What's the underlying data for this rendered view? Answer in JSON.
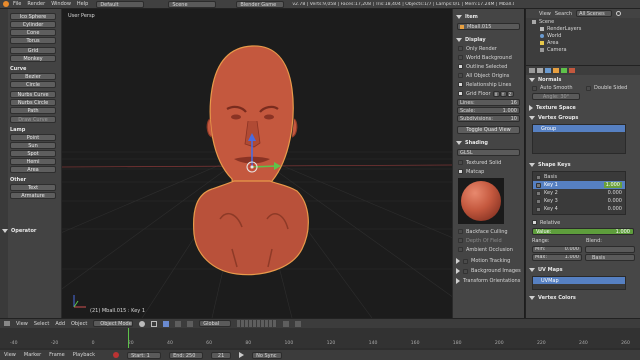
{
  "topbar": {
    "menus": [
      "File",
      "Render",
      "Window",
      "Help"
    ],
    "screen": "Default",
    "scene": "Scene",
    "engine": "Blender Game",
    "stats": "v2.78 | Verts:9,058 | Faces:17,208 | Tris:18,404 | Objects:1/7 | Lamps:0/1 | Mem:17.24M | Mball.015"
  },
  "toolshelf": {
    "items_top": [
      "Ico Sphere",
      "Cylinder",
      "Cone",
      "Torus",
      "Grid",
      "Monkey"
    ],
    "curve_title": "Curve",
    "curve_items": [
      "Bezier",
      "Circle",
      "Nurbs Curve",
      "Nurbs Circle",
      "Path",
      "Draw Curve"
    ],
    "lamp_title": "Lamp",
    "lamp_items": [
      "Point",
      "Sun",
      "Spot",
      "Hemi",
      "Area"
    ],
    "other_title": "Other",
    "other_items": [
      "Text",
      "Armature"
    ],
    "operator": "Operator"
  },
  "viewport": {
    "label": "User Persp",
    "object_label": "(21) Mball.015 : Key 1"
  },
  "npanel": {
    "item_title": "Item",
    "item_name": "Mball.015",
    "display_title": "Display",
    "display_checks": [
      "Only Render",
      "World Background",
      "Outline Selected",
      "All Object Origins",
      "Relationship Lines"
    ],
    "grid_floor": "Grid Floor",
    "axes": [
      "X",
      "Y",
      "Z"
    ],
    "lines_label": "Lines:",
    "lines_value": "16",
    "scale_label": "Scale:",
    "scale_value": "1.000",
    "subdiv_label": "Subdivisions:",
    "subdiv_value": "10",
    "toggle_quad": "Toggle Quad View",
    "shading_title": "Shading",
    "shading_mode": "GLSL",
    "textured_solid": "Textured Solid",
    "matcap": "Matcap",
    "lower_checks": [
      "Backface Culling",
      "Depth Of Field",
      "Ambient Occlusion"
    ],
    "sections": [
      "Motion Tracking",
      "Background Images",
      "Transform Orientations"
    ]
  },
  "outliner": {
    "tabs": [
      "View",
      "Search",
      "All Scenes"
    ],
    "items": [
      "Scene",
      "RenderLayers",
      "World",
      "Area",
      "Camera"
    ]
  },
  "properties": {
    "normals_title": "Normals",
    "auto_smooth": "Auto Smooth",
    "double_sided": "Double Sided",
    "angle": "Angle: 30°",
    "texture_space": "Texture Space",
    "vertex_groups": "Vertex Groups",
    "group_name": "Group",
    "shape_keys_title": "Shape Keys",
    "shape_keys": [
      {
        "name": "Basis",
        "value": ""
      },
      {
        "name": "Key 1",
        "value": "1.000"
      },
      {
        "name": "Key 2",
        "value": "0.000"
      },
      {
        "name": "Key 3",
        "value": "0.000"
      },
      {
        "name": "Key 4",
        "value": "0.000"
      }
    ],
    "relative": "Relative",
    "value_label": "Value:",
    "value": "1.000",
    "range_label": "Range:",
    "blend_label": "Blend:",
    "min_label": "Min:",
    "min_value": "0.000",
    "max_label": "Max:",
    "max_value": "1.000",
    "blend_value": "Basis",
    "uv_maps": "UV Maps",
    "uv_name": "UVMap",
    "vertex_colors": "Vertex Colors"
  },
  "viewheader": {
    "menus": [
      "View",
      "Select",
      "Add",
      "Object"
    ],
    "mode": "Object Mode",
    "orientation": "Global"
  },
  "timeline": {
    "labels": [
      "View",
      "Marker",
      "Frame",
      "Playback"
    ],
    "start": "Start: 1",
    "end": "End: 250",
    "current": "21",
    "sync": "No Sync",
    "ticks": [
      "-40",
      "-20",
      "0",
      "20",
      "40",
      "60",
      "80",
      "100",
      "120",
      "140",
      "160",
      "180",
      "200",
      "220",
      "240",
      "260"
    ]
  },
  "colors": {
    "skin": "#c4583e",
    "accent": "#5680c2",
    "green_axis": "#5ec24a"
  }
}
